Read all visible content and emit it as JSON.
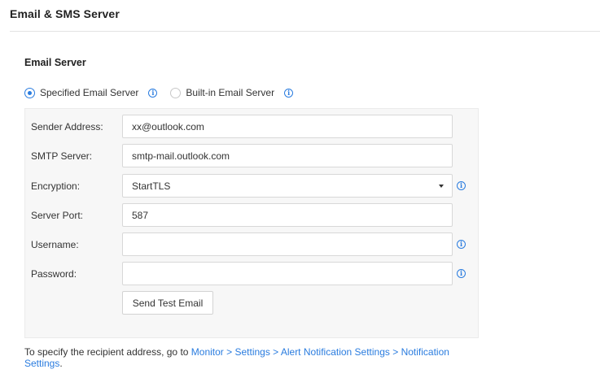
{
  "header": {
    "title": "Email & SMS Server"
  },
  "email_server": {
    "section_title": "Email Server",
    "options": [
      {
        "label": "Specified Email Server",
        "selected": true
      },
      {
        "label": "Built-in Email Server",
        "selected": false
      }
    ],
    "fields": {
      "sender_address": {
        "label": "Sender Address:",
        "value": "xx@outlook.com"
      },
      "smtp_server": {
        "label": "SMTP Server:",
        "value": "smtp-mail.outlook.com"
      },
      "encryption": {
        "label": "Encryption:",
        "value": "StartTLS"
      },
      "server_port": {
        "label": "Server Port:",
        "value": "587"
      },
      "username": {
        "label": "Username:",
        "value": ""
      },
      "password": {
        "label": "Password:",
        "value": ""
      }
    },
    "test_button_label": "Send Test Email"
  },
  "footer": {
    "prefix": "To specify the recipient address, go to ",
    "link": "Monitor > Settings > Alert Notification Settings > Notification Settings",
    "suffix": "."
  },
  "icons": {
    "info": "info-icon",
    "accent_color": "#2a7cdf"
  }
}
